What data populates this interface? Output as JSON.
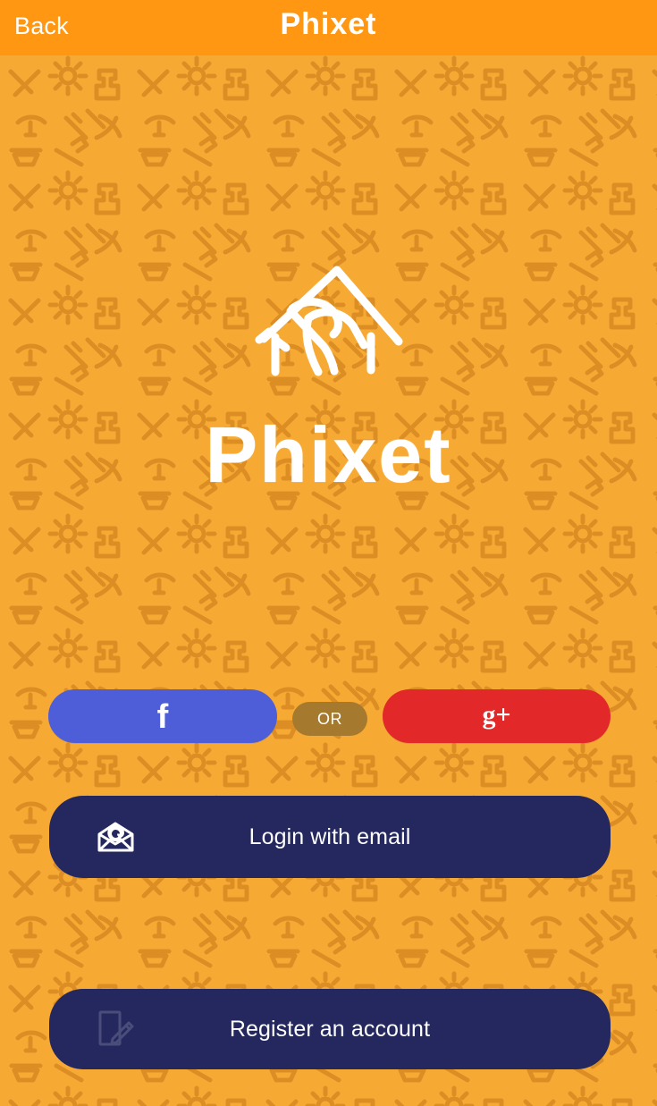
{
  "header": {
    "back_label": "Back",
    "title": "Phixet"
  },
  "brand": {
    "wordmark": "Phixet"
  },
  "social": {
    "or_label": "OR",
    "facebook_icon": "facebook-icon",
    "google_icon": "google-plus-icon"
  },
  "actions": {
    "email_login_label": "Login with email",
    "register_label": "Register an account"
  },
  "icons": {
    "email": "envelope-icon",
    "register": "tablet-pencil-icon",
    "logo": "house-tools-logo"
  },
  "colors": {
    "header": "#FF9712",
    "background": "#F7AA33",
    "pattern": "#DC8E24",
    "facebook": "#4D5ED8",
    "google": "#E22828",
    "or_pill": "#A67A2E",
    "primary_button": "#24285F",
    "text": "#FFFFFF"
  }
}
